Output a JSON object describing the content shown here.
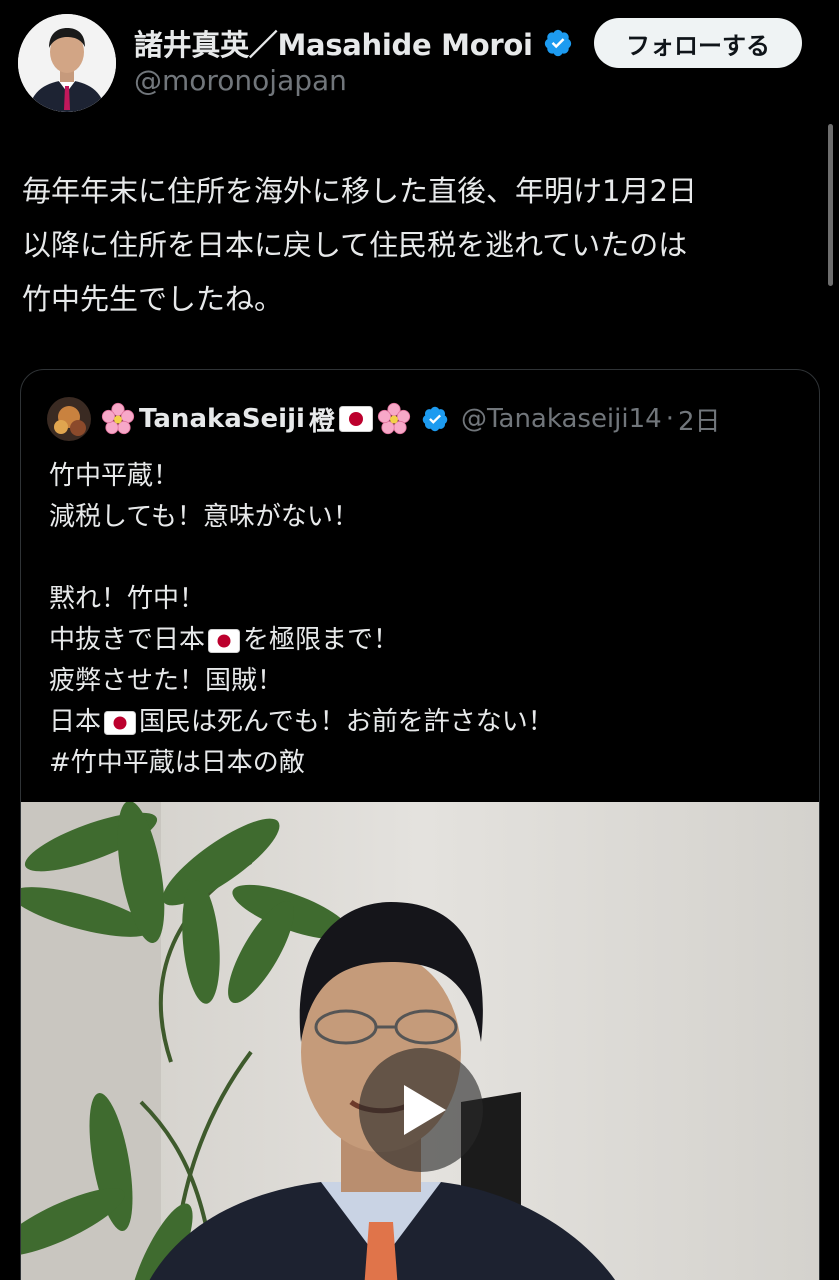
{
  "author": {
    "display_name": "諸井真英／Masahide Moroi",
    "handle": "@moronojapan",
    "verified": true,
    "follow_label": "フォローする"
  },
  "tweet": {
    "lines": [
      "毎年年末に住所を海外に移した直後、年明け1月2日",
      "以降に住所を日本に戻して住民税を逃れていたのは",
      "竹中先生でしたね。"
    ]
  },
  "quote": {
    "display_name": "TanakaSeiji",
    "name_suffix": "橙",
    "handle": "@Tanakaseiji14",
    "separator": "·",
    "time": "2日",
    "lines": {
      "l1": "竹中平蔵！",
      "l2": "減税しても！意味がない！",
      "l3": "黙れ！竹中！",
      "l4a": "中抜きで日本",
      "l4b": "を極限まで！",
      "l5": "疲弊させた！国賊！",
      "l6a": "日本",
      "l6b": "国民は死んでも！お前を許さない！",
      "l7": "#竹中平蔵は日本の敵"
    }
  },
  "icons": {
    "verified": "verified-badge-icon",
    "flower": "cherry-blossom-icon",
    "flag": "japan-flag-icon",
    "play": "play-icon"
  },
  "colors": {
    "background": "#000000",
    "text": "#e7e9ea",
    "secondary_text": "#71767b",
    "verified_blue": "#1d9bf0",
    "follow_button_bg": "#eff3f4"
  }
}
